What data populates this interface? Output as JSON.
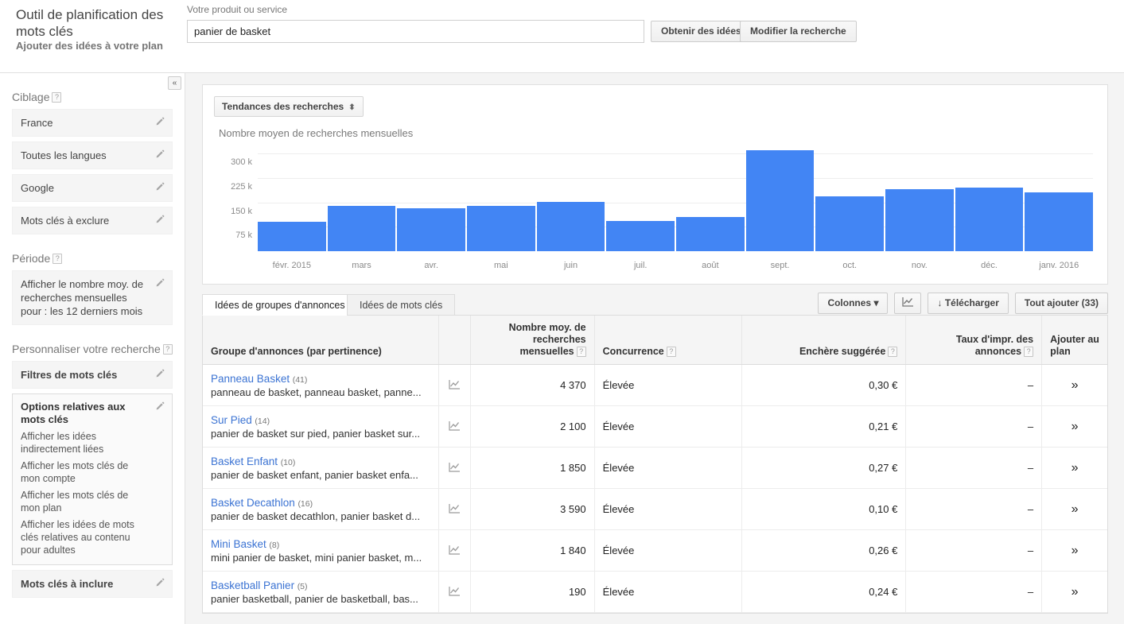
{
  "header": {
    "app_title": "Outil de planification des mots clés",
    "app_subtitle": "Ajouter des idées à votre plan",
    "search_label": "Votre produit ou service",
    "search_value": "panier de basket",
    "search_placeholder": "Votre produit ou service",
    "get_ideas_label": "Obtenir des idées",
    "modify_label": "Modifier la recherche"
  },
  "sidebar": {
    "collapse_icon": "«",
    "targeting": {
      "title": "Ciblage",
      "help": "?",
      "items": [
        {
          "label": "France"
        },
        {
          "label": "Toutes les langues"
        },
        {
          "label": "Google"
        },
        {
          "label": "Mots clés à exclure"
        }
      ]
    },
    "period": {
      "title": "Période",
      "help": "?",
      "item": "Afficher le nombre moy. de recherches mensuelles pour : les 12 derniers mois"
    },
    "customize": {
      "title": "Personnaliser votre recherche",
      "help": "?",
      "filters_label": "Filtres de mots clés",
      "options_title": "Options relatives aux mots clés",
      "options": [
        "Afficher les idées indirectement liées",
        "Afficher les mots clés de mon compte",
        "Afficher les mots clés de mon plan",
        "Afficher les idées de mots clés relatives au contenu pour adultes"
      ],
      "include_label": "Mots clés à inclure"
    }
  },
  "chart_data": {
    "type": "bar",
    "title": "",
    "selector_label": "Tendances des recherches",
    "ylabel": "Nombre moyen de recherches mensuelles",
    "xlabel": "",
    "categories": [
      "févr. 2015",
      "mars",
      "avr.",
      "mai",
      "juin",
      "juil.",
      "août",
      "sept.",
      "oct.",
      "nov.",
      "déc.",
      "janv. 2016"
    ],
    "values": [
      90000,
      140000,
      132000,
      140000,
      152000,
      93000,
      106000,
      310000,
      169000,
      191000,
      196000,
      180000
    ],
    "ytick_labels": [
      "300 k",
      "225 k",
      "150 k",
      "75 k"
    ],
    "yticks": [
      300000,
      225000,
      150000,
      75000
    ],
    "ylim": [
      0,
      330000
    ],
    "grid": true,
    "legend": "none",
    "bar_color": "#4285f4"
  },
  "tabs": [
    {
      "label": "Idées de groupes d'annonces",
      "active": true
    },
    {
      "label": "Idées de mots clés",
      "active": false
    }
  ],
  "toolbar": {
    "columns_label": "Colonnes",
    "columns_caret": "▾",
    "graph_icon": "graph-icon",
    "download_label": "Télécharger",
    "download_icon": "↓",
    "add_all_label": "Tout ajouter (33)"
  },
  "table": {
    "headers": {
      "group": "Groupe d'annonces (par pertinence)",
      "searches": "Nombre moy. de recherches mensuelles",
      "competition": "Concurrence",
      "bid": "Enchère suggérée",
      "impr": "Taux d'impr. des annonces",
      "add": "Ajouter au plan",
      "help": "?"
    },
    "rows": [
      {
        "name": "Panneau Basket",
        "count": "(41)",
        "keywords": "panneau de basket, panneau basket, panne...",
        "searches": "4 370",
        "competition": "Élevée",
        "bid": "0,30 €",
        "impr": "–",
        "add": "»"
      },
      {
        "name": "Sur Pied",
        "count": "(14)",
        "keywords": "panier de basket sur pied, panier basket sur...",
        "searches": "2 100",
        "competition": "Élevée",
        "bid": "0,21 €",
        "impr": "–",
        "add": "»"
      },
      {
        "name": "Basket Enfant",
        "count": "(10)",
        "keywords": "panier de basket enfant, panier basket enfa...",
        "searches": "1 850",
        "competition": "Élevée",
        "bid": "0,27 €",
        "impr": "–",
        "add": "»"
      },
      {
        "name": "Basket Decathlon",
        "count": "(16)",
        "keywords": "panier de basket decathlon, panier basket d...",
        "searches": "3 590",
        "competition": "Élevée",
        "bid": "0,10 €",
        "impr": "–",
        "add": "»"
      },
      {
        "name": "Mini Basket",
        "count": "(8)",
        "keywords": "mini panier de basket, mini panier basket, m...",
        "searches": "1 840",
        "competition": "Élevée",
        "bid": "0,26 €",
        "impr": "–",
        "add": "»"
      },
      {
        "name": "Basketball Panier",
        "count": "(5)",
        "keywords": "panier basketball, panier de basketball, bas...",
        "searches": "190",
        "competition": "Élevée",
        "bid": "0,24 €",
        "impr": "–",
        "add": "»"
      }
    ]
  }
}
